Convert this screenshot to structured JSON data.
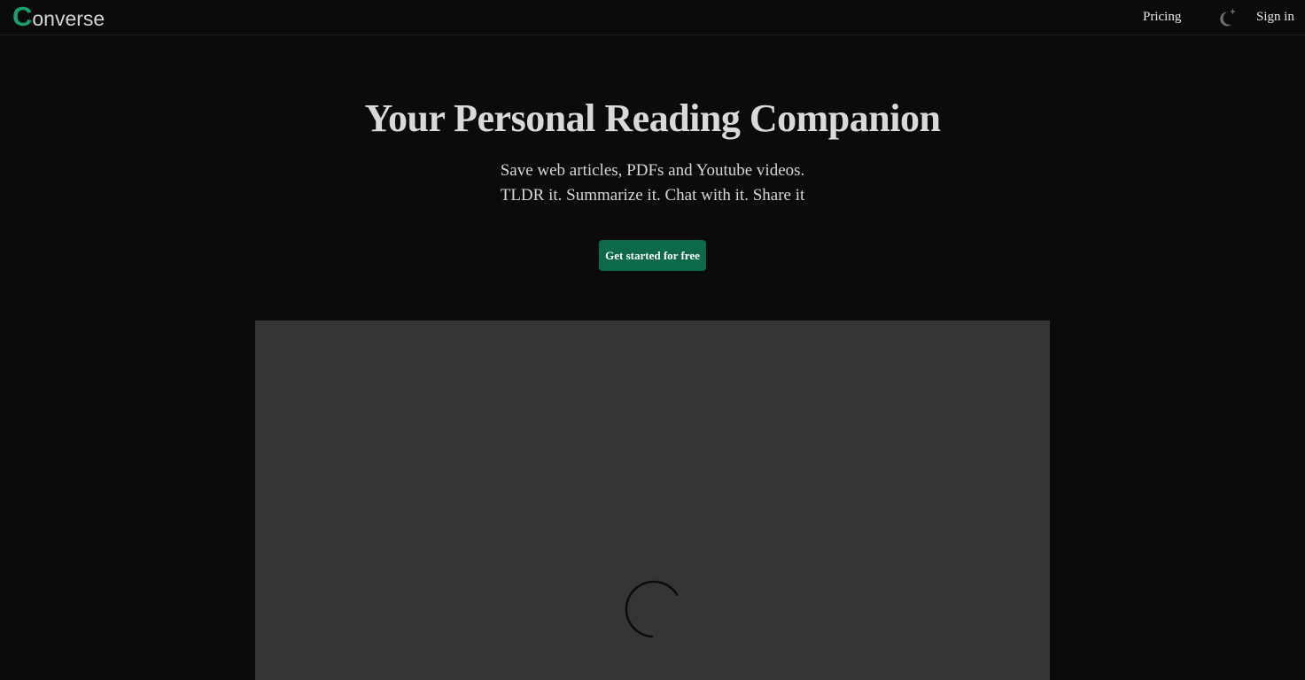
{
  "header": {
    "logo_initial": "C",
    "logo_rest": "onverse",
    "nav": {
      "pricing_label": "Pricing",
      "theme_icon": "moon-star-icon",
      "signin_label": "Sign in"
    }
  },
  "hero": {
    "title": "Your Personal Reading Companion",
    "subtitle_line1": "Save web articles, PDFs and Youtube videos.",
    "subtitle_line2": "TLDR it. Summarize it. Chat with it. Share it",
    "cta_label": "Get started for free"
  },
  "demo": {
    "loading_icon": "loading-spinner-icon"
  },
  "colors": {
    "background": "#0b0b0b",
    "brand_green": "#16a06c",
    "cta_green": "#0c6a4b",
    "panel": "#353535"
  }
}
